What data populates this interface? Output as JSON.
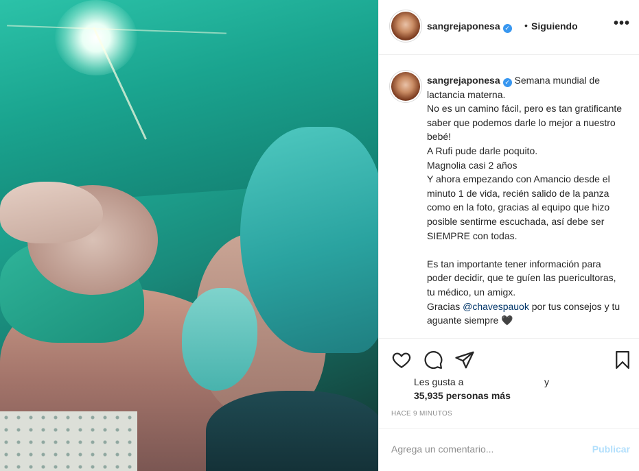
{
  "post": {
    "image_alt": "newborn on mother chest in operating room"
  },
  "header": {
    "username": "sangrejaponesa",
    "verified_icon": "verified-badge-icon",
    "separator": "•",
    "follow_status": "Siguiendo",
    "more_label": "•••"
  },
  "caption": {
    "username": "sangrejaponesa",
    "text_before_mention": "Semana mundial de lactancia materna.\nNo es un camino fácil, pero es tan gratificante saber que podemos darle lo mejor a nuestro bebé!\nA Rufi pude darle poquito.\nMagnolia casi 2 años\nY ahora empezando con Amancio desde el minuto 1 de vida, recién salido de la panza como en la foto, gracias al equipo que hizo posible sentirme escuchada, así debe ser SIEMPRE con todas.\n\nEs tan importante tener información para poder decidir, que te guíen las puericultoras, tu médico, un amigx.\nGracias ",
    "mention": "@chavespauok",
    "text_after_mention": " por tus consejos y tu aguante siempre 🖤"
  },
  "actions": {
    "like_icon": "heart-icon",
    "comment_icon": "comment-icon",
    "share_icon": "paper-plane-icon",
    "save_icon": "bookmark-icon"
  },
  "likes": {
    "prefix": "Les gusta a",
    "conjunction": "y",
    "count_text": "35,935 personas más"
  },
  "timestamp": "HACE 9 MINUTOS",
  "comment": {
    "placeholder": "Agrega un comentario...",
    "publish_label": "Publicar"
  },
  "colors": {
    "accent": "#3897f0",
    "publish_disabled": "#b2dffc",
    "mention": "#003569",
    "secondary_text": "#8e8e8e"
  }
}
